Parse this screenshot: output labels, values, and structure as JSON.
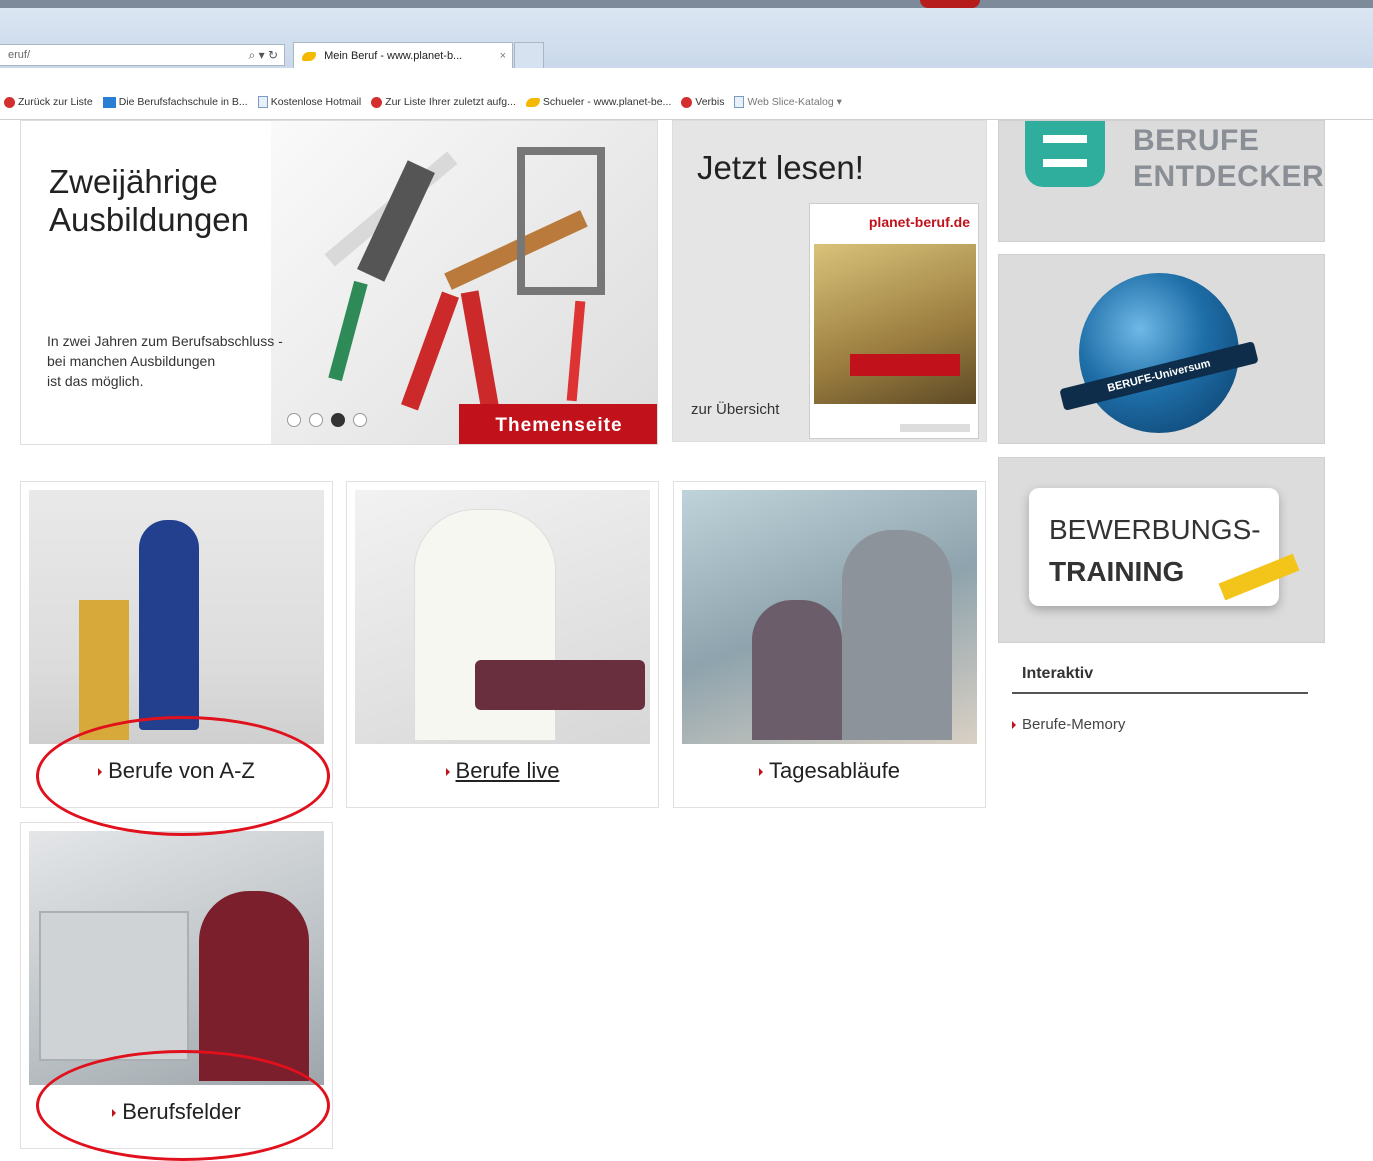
{
  "browser": {
    "address_value": "eruf/",
    "address_controls": "⌕ ▾ ↻",
    "tab_title": "Mein Beruf - www.planet-b...",
    "tab_close": "×",
    "favorites": [
      {
        "label": "Zurück zur Liste",
        "icon": "red-circle-icon"
      },
      {
        "label": "Die Berufsfachschule in B...",
        "icon": "blue-page-icon"
      },
      {
        "label": "Kostenlose Hotmail",
        "icon": "page-icon"
      },
      {
        "label": "Zur Liste Ihrer zuletzt aufg...",
        "icon": "red-circle-icon"
      },
      {
        "label": "Schueler - www.planet-be...",
        "icon": "yellow-fav-icon"
      },
      {
        "label": "Verbis",
        "icon": "red-circle-icon"
      },
      {
        "label": "Web Slice-Katalog ▾",
        "icon": "page-icon"
      }
    ]
  },
  "hero": {
    "title_line1": "Zweijährige",
    "title_line2": "Ausbildungen",
    "text_line1": "In zwei Jahren zum Berufsabschluss -",
    "text_line2": "bei manchen Ausbildungen",
    "text_line3": "ist das möglich.",
    "button": "Themenseite",
    "slide_count": 4,
    "active_slide": 3
  },
  "magazine": {
    "title": "Jetzt lesen!",
    "link": "zur Übersicht",
    "cover_brand": "planet-beruf.de"
  },
  "side": {
    "entdecker_line1": "BERUFE",
    "entdecker_line2": "ENTDECKER",
    "universum_label": "BERUFE-Universum",
    "bewerbung_line1": "BEWERBUNGS-",
    "bewerbung_line2": "TRAINING",
    "interaktiv_heading": "Interaktiv",
    "interaktiv_link": "Berufe-Memory"
  },
  "tiles": [
    {
      "label": "Berufe von A-Z"
    },
    {
      "label": "Berufe live"
    },
    {
      "label": "Tagesabläufe"
    },
    {
      "label": "Berufsfelder"
    }
  ],
  "colors": {
    "accent_red": "#c1121b",
    "annotation_red": "#e0101c",
    "teal": "#2fae9e"
  }
}
